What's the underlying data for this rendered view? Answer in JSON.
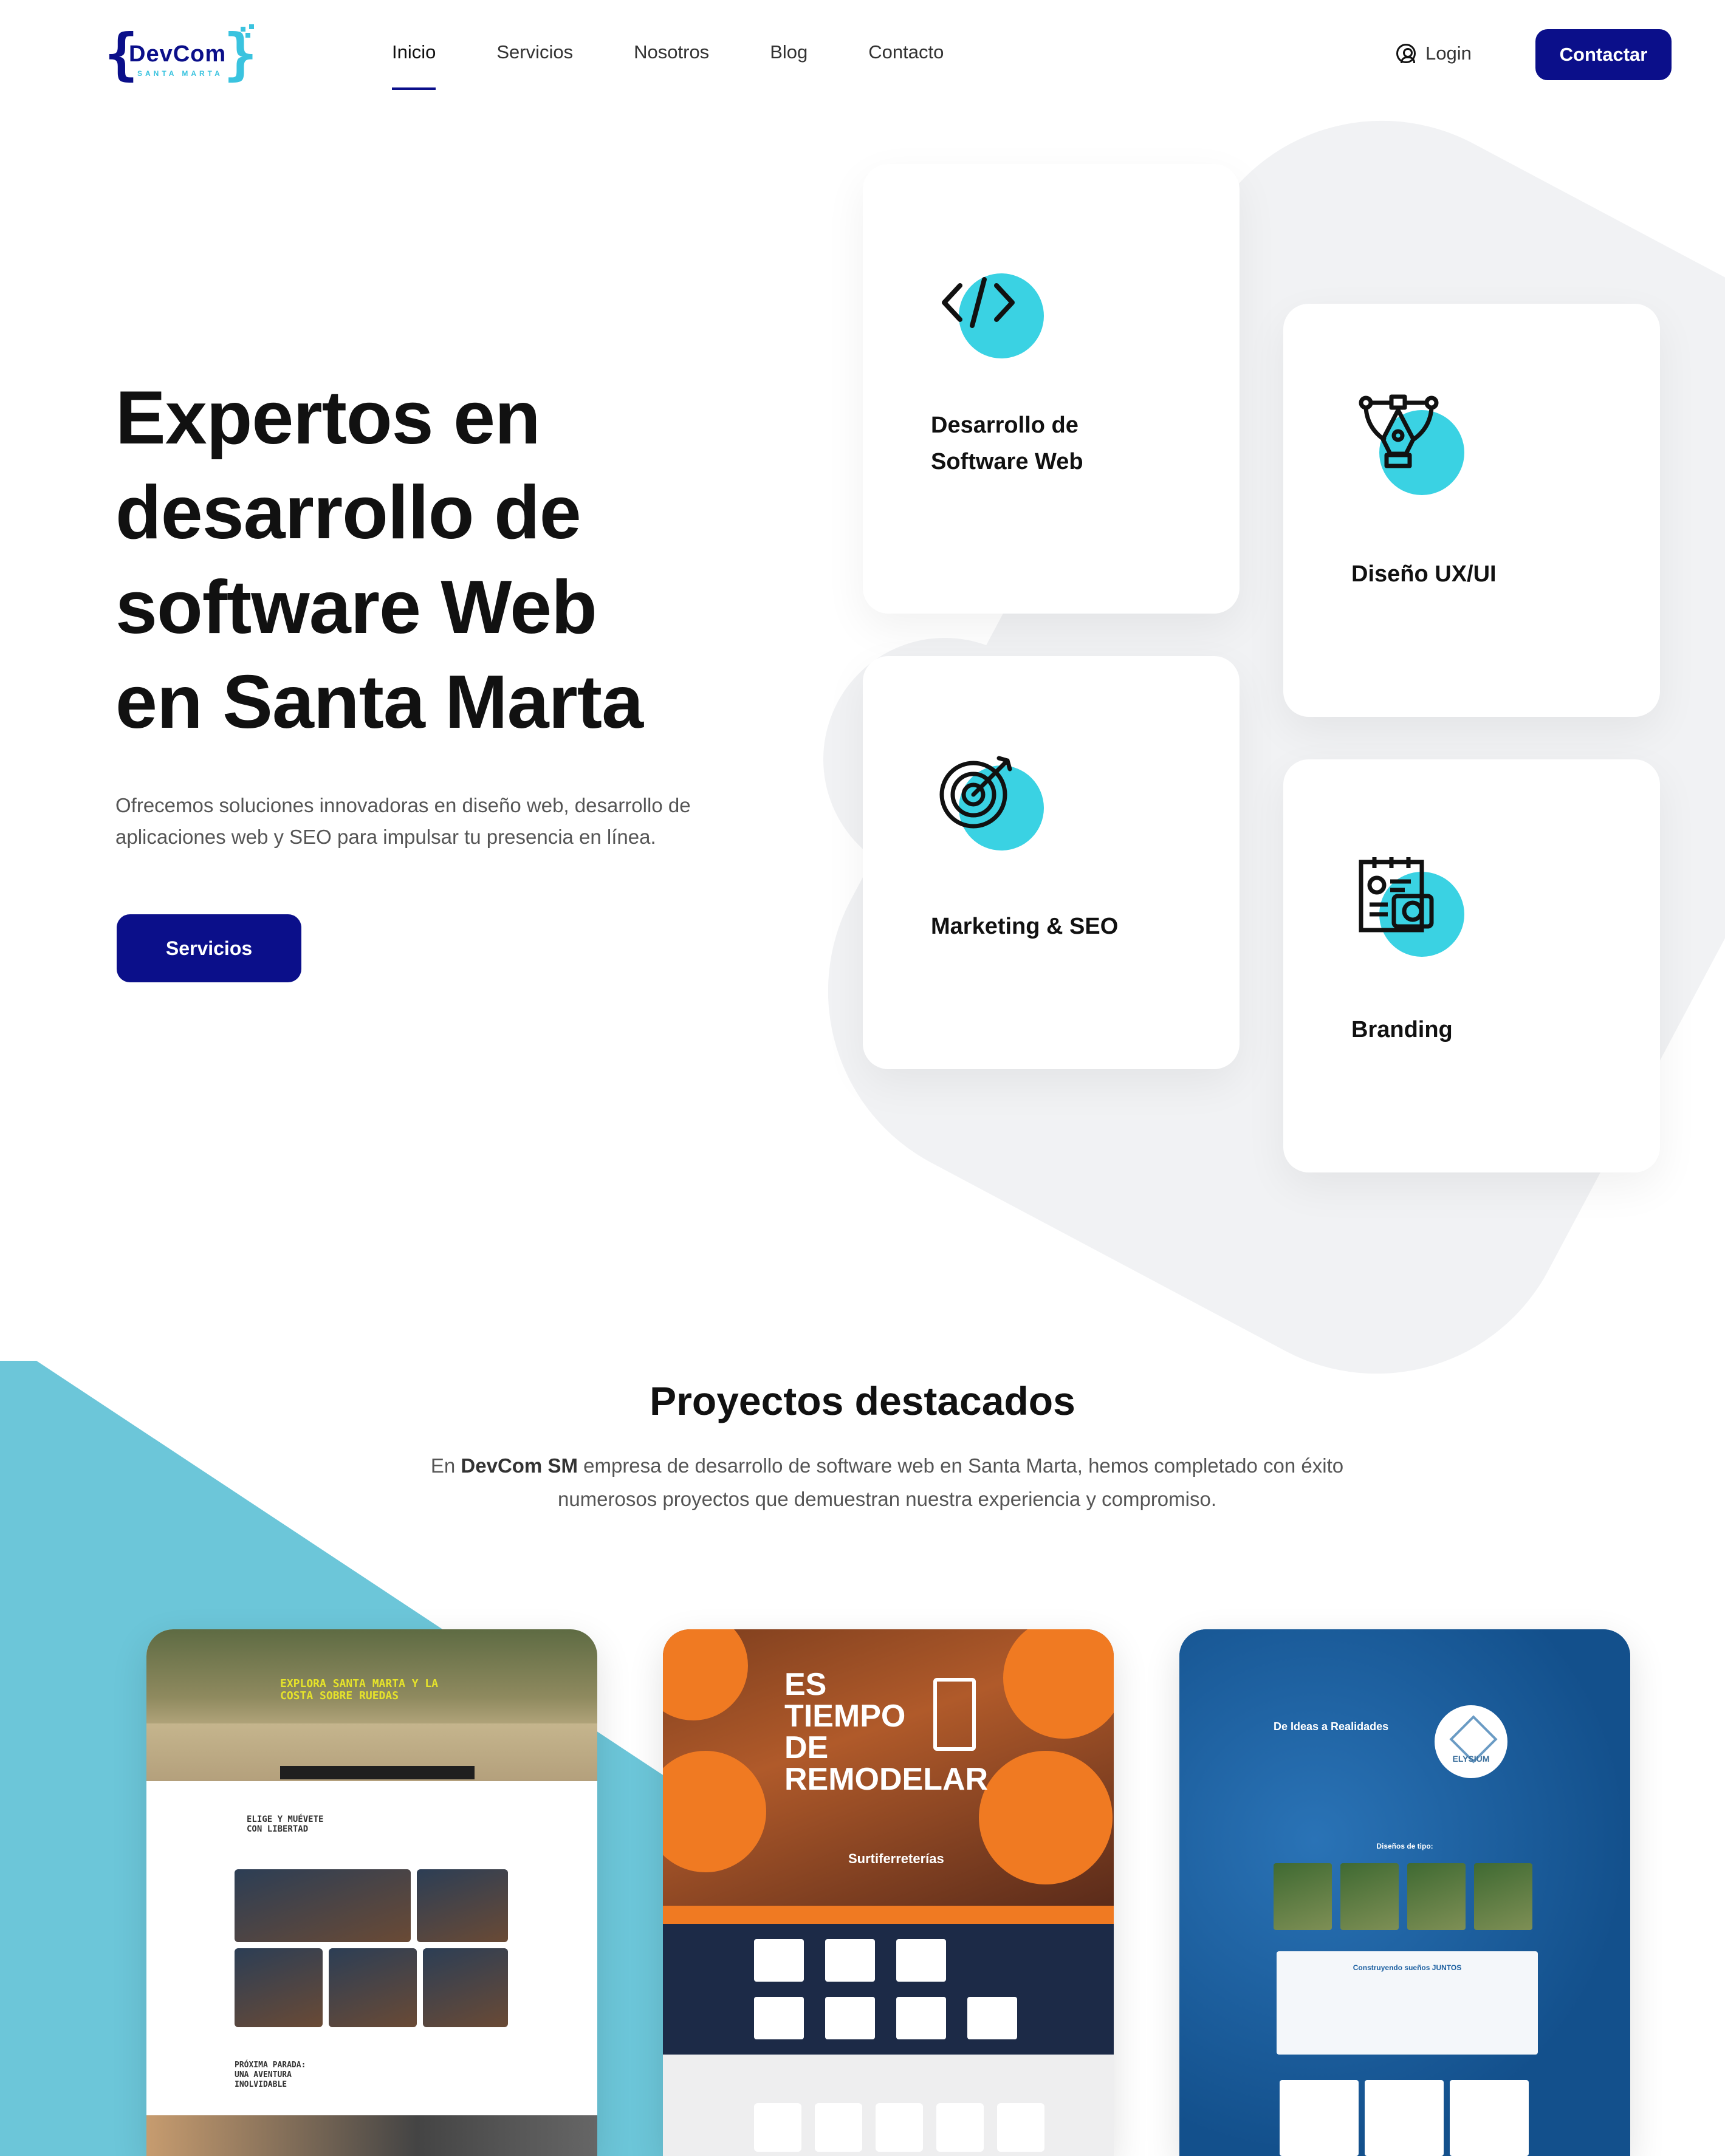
{
  "brand": {
    "name": "DevCom",
    "tagline": "SANTA MARTA"
  },
  "nav": {
    "items": [
      "Inicio",
      "Servicios",
      "Nosotros",
      "Blog",
      "Contacto"
    ],
    "active": "Inicio",
    "login": "Login",
    "cta": "Contactar"
  },
  "hero": {
    "title_lines": [
      "Expertos en",
      "desarrollo de",
      "software Web",
      "en Santa Marta"
    ],
    "description": "Ofrecemos soluciones innovadoras en diseño web, desarrollo de aplicaciones web y SEO para impulsar tu presencia en línea.",
    "button": "Servicios"
  },
  "services": [
    {
      "label_lines": [
        "Desarrollo de",
        "Software Web"
      ],
      "icon": "code-icon"
    },
    {
      "label_lines": [
        "Diseño UX/UI"
      ],
      "icon": "pen-tool-icon"
    },
    {
      "label_lines": [
        "Marketing & SEO"
      ],
      "icon": "target-icon"
    },
    {
      "label_lines": [
        "Branding"
      ],
      "icon": "branding-icon"
    }
  ],
  "projects_section": {
    "title": "Proyectos destacados",
    "desc_pre": "En ",
    "desc_brand": "DevCom SM",
    "desc_post": " empresa de desarrollo de software web en Santa Marta, hemos completado con éxito numerosos proyectos que demuestran nuestra experiencia y compromiso."
  },
  "projects": [
    {
      "headline_lines": [
        "EXPLORA SANTA MARTA Y LA",
        "COSTA SOBRE RUEDAS"
      ],
      "section_lines": [
        "ELIGE Y MUÉVETE",
        "CON LIBERTAD"
      ],
      "footer_lines": [
        "PRÓXIMA PARADA:",
        "UNA AVENTURA",
        "INOLVIDABLE"
      ]
    },
    {
      "headline_lines": [
        "ES",
        "TIEMPO",
        "DE",
        "REMODELAR"
      ],
      "brand": "Surtiferreterías"
    },
    {
      "headline": "De Ideas a Realidades",
      "logo_text": "ELYSIUM",
      "section": "Diseños de tipo:",
      "panel_title": "Construyendo sueños JUNTOS"
    }
  ],
  "colors": {
    "primary": "#0b0f8a",
    "accent": "#3ad2e3",
    "teal": "#6cc6d9"
  }
}
